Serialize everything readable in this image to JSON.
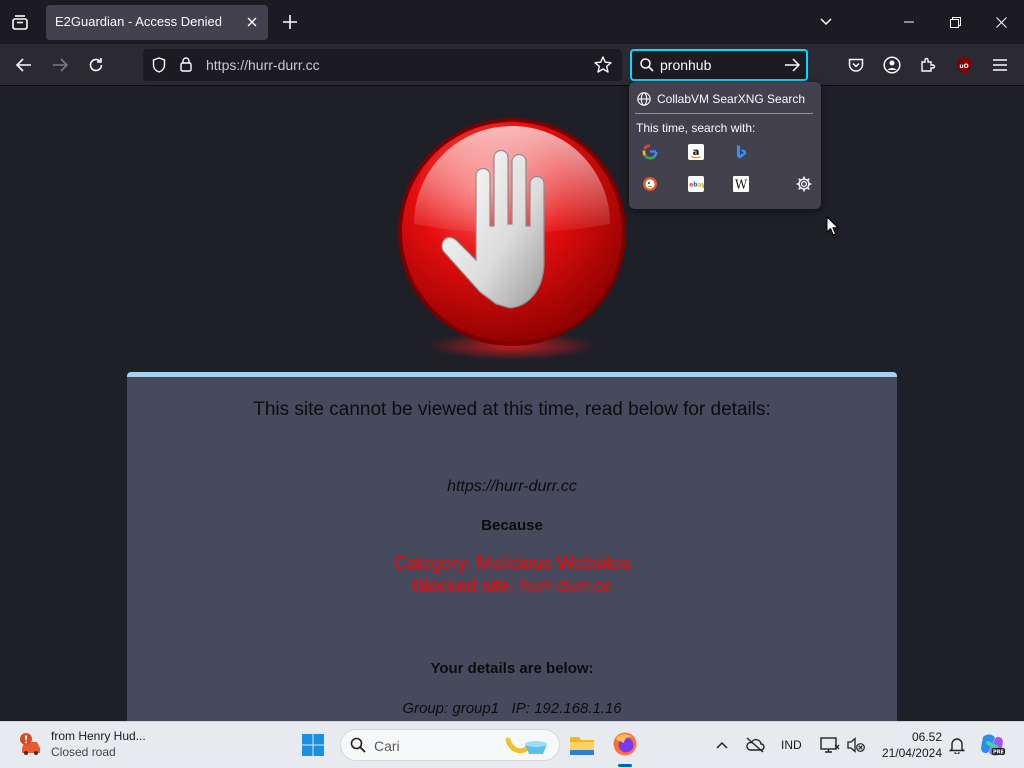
{
  "browser": {
    "tab": {
      "title": "E2Guardian - Access Denied"
    },
    "url": "https://hurr-durr.cc",
    "search": {
      "value": "pronhub"
    },
    "search_popup": {
      "engine_name": "CollabVM SearXNG Search",
      "hint": "This time, search with:",
      "engines": [
        "google-icon",
        "amazon-icon",
        "bing-icon",
        "duckduckgo-icon",
        "ebay-icon",
        "wikipedia-icon",
        "settings-gear-icon"
      ]
    },
    "colors": {
      "accent": "#00ddff",
      "toolbar": "#2b2a33",
      "tab_active": "#42414d"
    }
  },
  "page": {
    "heading": "This site cannot be viewed at this time, read below for details:",
    "blocked_url": "https://hurr-durr.cc",
    "because": "Because",
    "category": "Category: Malicious Websites",
    "blocked_site": "Blocked site: hurr-durr.cc",
    "details_heading": "Your details are below:",
    "group_ip": "Group: group1   IP: 192.168.1.16",
    "colors": {
      "card_bg": "#474a5d",
      "card_border": "#a8d0ef",
      "alert_red": "#ff0000"
    }
  },
  "taskbar": {
    "weather_title": "from Henry Hud...",
    "weather_sub": "Closed road",
    "search_placeholder": "Cari",
    "language": "IND",
    "time": "06.52",
    "date": "21/04/2024"
  }
}
